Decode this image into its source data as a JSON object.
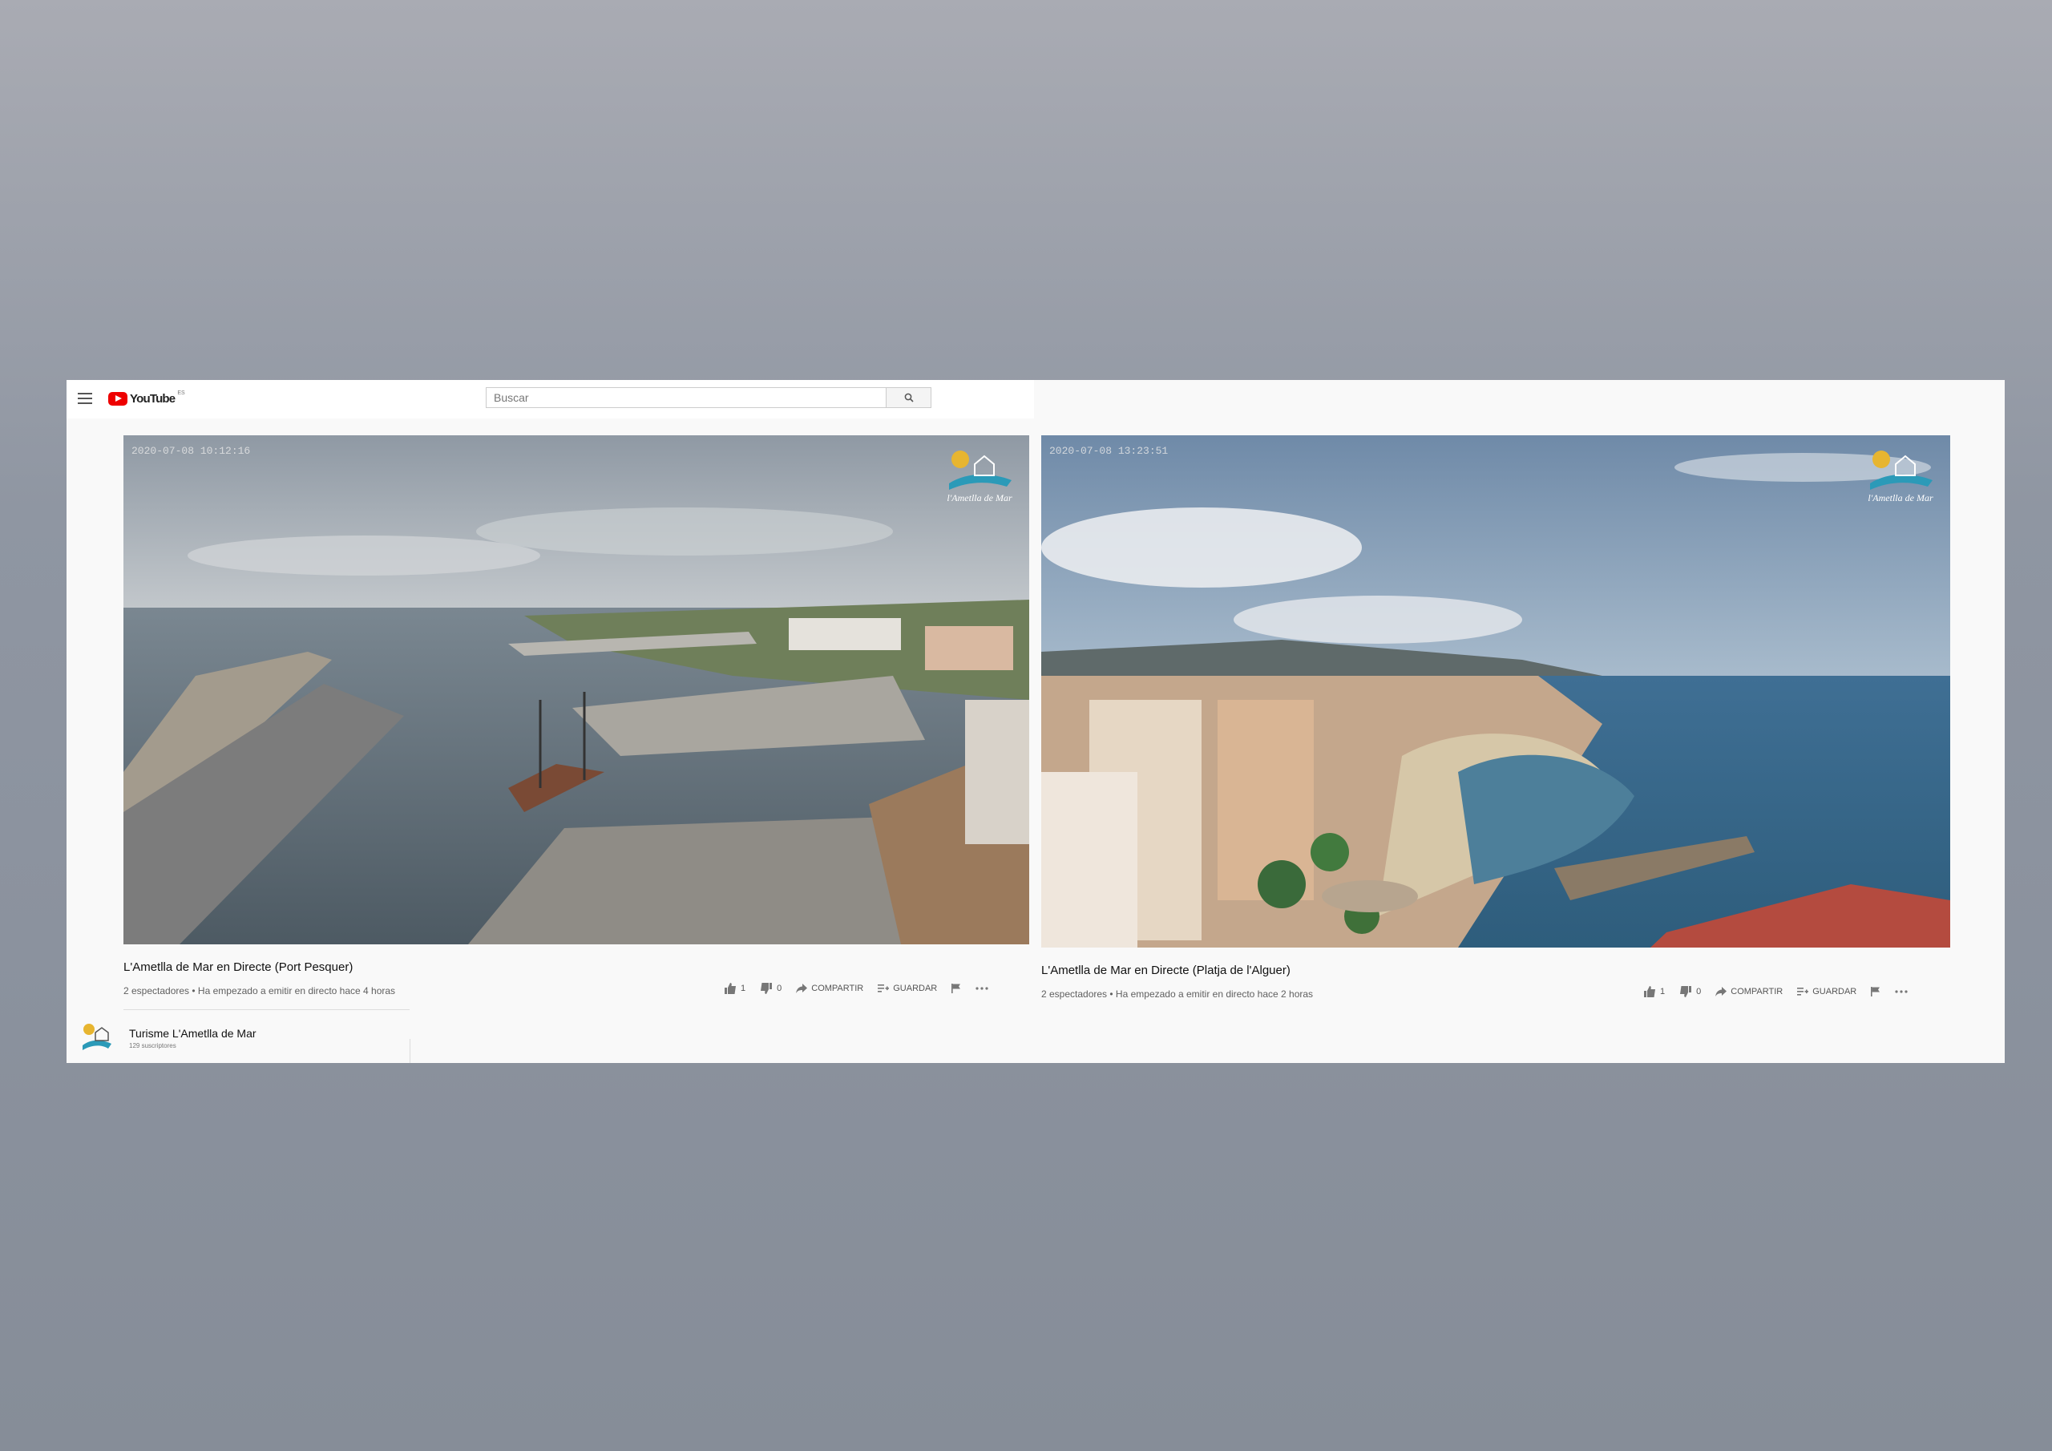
{
  "app": {
    "logo_text": "YouTube",
    "region_code": "ES",
    "search": {
      "placeholder": "Buscar",
      "value": ""
    }
  },
  "videos": [
    {
      "overlay_timestamp": "2020-07-08 10:12:16",
      "title": "L'Ametlla de Mar en Directe (Port Pesquer)",
      "meta": "2 espectadores • Ha empezado a emitir en directo hace 4 horas",
      "likes": "1",
      "dislikes": "0",
      "share_label": "Compartir",
      "save_label": "Guardar",
      "brand_label": "l'Ametlla de Mar"
    },
    {
      "overlay_timestamp": "2020-07-08 13:23:51",
      "title": "L'Ametlla de Mar en Directe (Platja de l'Alguer)",
      "meta": "2 espectadores • Ha empezado a emitir en directo hace 2 horas",
      "likes": "1",
      "dislikes": "0",
      "share_label": "Compartir",
      "save_label": "Guardar",
      "brand_label": "l'Ametlla de Mar"
    }
  ],
  "channel": {
    "name": "Turisme L'Ametlla de Mar",
    "subscribers": "129 suscriptores"
  },
  "colors": {
    "background": "#8f96a2",
    "panel": "#f9f9f9",
    "brand_red": "#ee0000"
  }
}
